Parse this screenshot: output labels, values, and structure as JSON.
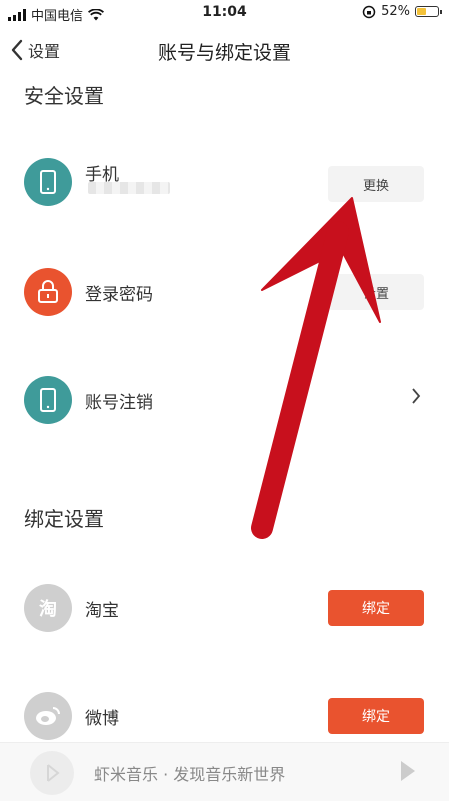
{
  "status_bar": {
    "carrier": "中国电信",
    "time": "11:04",
    "battery_percent": "52%",
    "battery_level": 0.52,
    "battery_color": "#f3c23a"
  },
  "nav": {
    "back_label": "设置",
    "title": "账号与绑定设置"
  },
  "security": {
    "title": "安全设置",
    "phone": {
      "label": "手机",
      "button": "更换",
      "icon": "phone-icon"
    },
    "password": {
      "label": "登录密码",
      "button": "设置",
      "icon": "lock-icon"
    },
    "cancel": {
      "label": "账号注销",
      "icon": "phone-icon"
    }
  },
  "binding": {
    "title": "绑定设置",
    "taobao": {
      "label": "淘宝",
      "button": "绑定",
      "icon_text": "淘"
    },
    "weibo": {
      "label": "微博",
      "button": "绑定",
      "icon": "weibo-icon"
    }
  },
  "bottom_bar": {
    "text": "虾米音乐 · 发现音乐新世界"
  },
  "colors": {
    "teal": "#3f9b9a",
    "orange": "#e9532f",
    "gray_icon": "#cfcfcf",
    "annotation_red": "#c8101d"
  }
}
